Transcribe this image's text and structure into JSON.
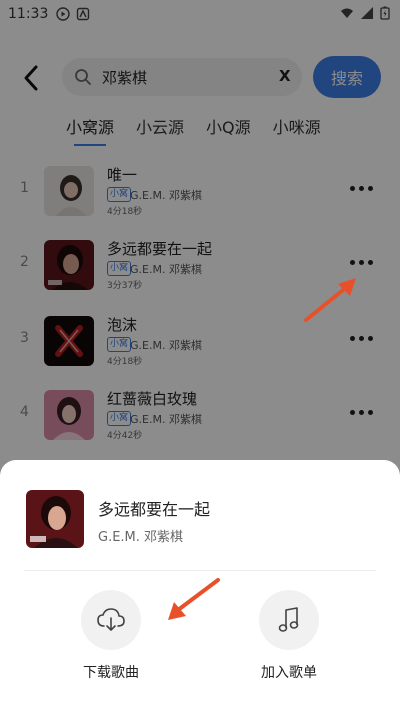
{
  "status_bar": {
    "time": "11:33"
  },
  "search": {
    "query": "邓紫棋",
    "placeholder": "",
    "clear_label": "X",
    "button_label": "搜索"
  },
  "tabs": [
    {
      "label": "小窝源",
      "active": true
    },
    {
      "label": "小云源",
      "active": false
    },
    {
      "label": "小Q源",
      "active": false
    },
    {
      "label": "小咪源",
      "active": false
    }
  ],
  "songs": [
    {
      "index": "1",
      "title": "唯一",
      "source": "小窝",
      "artist": "G.E.M. 邓紫棋",
      "duration": "4分18秒"
    },
    {
      "index": "2",
      "title": "多远都要在一起",
      "source": "小窝",
      "artist": "G.E.M. 邓紫棋",
      "duration": "3分37秒"
    },
    {
      "index": "3",
      "title": "泡沫",
      "source": "小窝",
      "artist": "G.E.M. 邓紫棋",
      "duration": "4分18秒"
    },
    {
      "index": "4",
      "title": "红蔷薇白玫瑰",
      "source": "小窝",
      "artist": "G.E.M. 邓紫棋",
      "duration": "4分42秒"
    }
  ],
  "sheet": {
    "title": "多远都要在一起",
    "artist": "G.E.M. 邓紫棋",
    "actions": [
      {
        "label": "下载歌曲",
        "icon": "cloud-download-icon"
      },
      {
        "label": "加入歌单",
        "icon": "music-note-icon"
      }
    ]
  },
  "colors": {
    "accent": "#3c7ee8",
    "arrow": "#e8502a",
    "overlay": "rgba(0,0,0,0.45)"
  }
}
